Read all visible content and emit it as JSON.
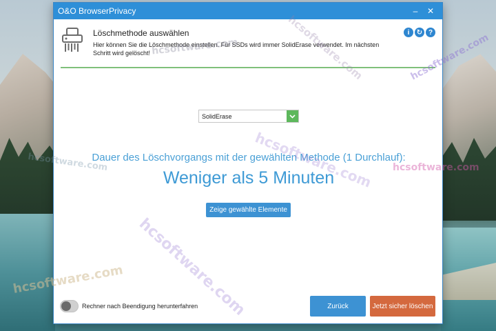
{
  "window": {
    "title": "O&O BrowserPrivacy",
    "minimize_label": "–",
    "close_label": "✕"
  },
  "header": {
    "title": "Löschmethode auswählen",
    "description": "Hier können Sie die Löschmethode einstellen. Für SSDs wird immer SolidErase verwendet. Im nächsten Schritt wird gelöscht!",
    "info_icon_glyph": "i",
    "refresh_icon_glyph": "↻",
    "help_icon_glyph": "?"
  },
  "method": {
    "selected": "SolidErase"
  },
  "duration": {
    "label": "Dauer des Löschvorgangs mit der gewählten Methode (1 Durchlauf):",
    "value": "Weniger als 5 Minuten"
  },
  "show_elements_label": "Zeige gewählte Elemente",
  "shutdown_toggle": {
    "label": "Rechner nach Beendigung herunterfahren",
    "enabled": false
  },
  "buttons": {
    "back_label": "Zurück",
    "delete_label": "Jetzt sicher löschen"
  },
  "watermark_text": "hcsoftware.com",
  "colors": {
    "titlebar": "#2e8fd8",
    "accent_blue": "#3d92d3",
    "delete_orange": "#d4693e",
    "divider_green": "#7fc07a",
    "select_button_green": "#5db85c"
  }
}
